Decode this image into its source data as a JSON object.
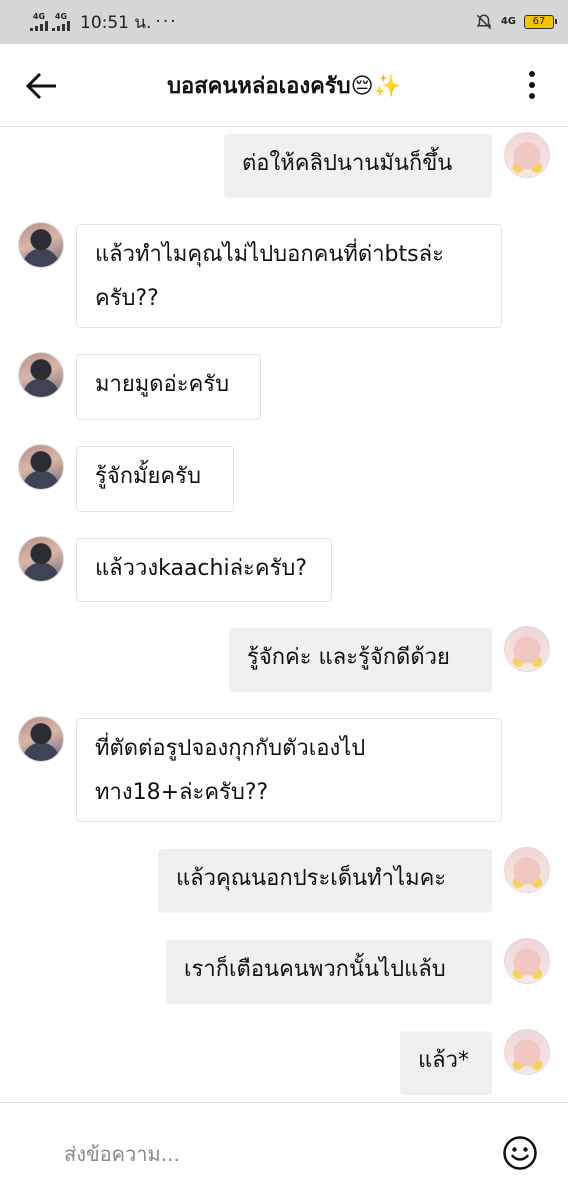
{
  "status_bar": {
    "signal_1_label": "4G",
    "signal_2_label": "4G",
    "time": "10:51 น.",
    "dots": "···",
    "network_label": "4G",
    "battery": "67"
  },
  "header": {
    "title": "บอสคนหล่อเองครับ",
    "title_emoji": "😔✨"
  },
  "messages": [
    {
      "side": "out",
      "text": "ต่อให้คลิปนานมันก็ขึ้น"
    },
    {
      "side": "in",
      "lines": [
        "แล้วทำไมคุณไม่ไปบอกคนที่ด่าbtsล่ะ",
        "ครับ??"
      ]
    },
    {
      "side": "in",
      "text": "มายมูดอ่ะครับ"
    },
    {
      "side": "in",
      "text": "รู้จักมั้ยครับ"
    },
    {
      "side": "in",
      "text": "แล้ววงkaachiล่ะครับ?"
    },
    {
      "side": "out",
      "text": "รู้จักค่ะ และรู้จักดีด้วย"
    },
    {
      "side": "in",
      "lines": [
        "ที่ตัดต่อรูปจองกุกกับตัวเองไป",
        "ทาง18+ล่ะครับ??"
      ]
    },
    {
      "side": "out",
      "text": "แล้วคุณนอกประเด็นทำไมคะ"
    },
    {
      "side": "out",
      "text": "เราก็เตือนคนพวกนั้นไปแล้บ"
    },
    {
      "side": "out",
      "text": "แล้ว*"
    }
  ],
  "input": {
    "placeholder": "ส่งข้อความ..."
  }
}
